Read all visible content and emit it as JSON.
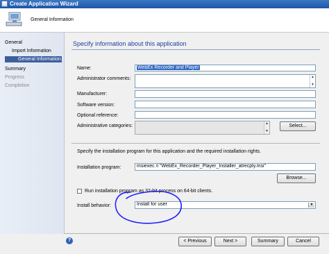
{
  "window": {
    "title": "Create Application Wizard"
  },
  "header": {
    "title": "General Information"
  },
  "nav": {
    "items": [
      {
        "label": "General"
      },
      {
        "label": "Import Information"
      },
      {
        "label": "General Information"
      },
      {
        "label": "Summary"
      },
      {
        "label": "Progress"
      },
      {
        "label": "Completion"
      }
    ]
  },
  "main": {
    "heading": "Specify information about this application",
    "name_label": "Name:",
    "name_value": "WebEx Recorder and Player",
    "admin_comments_label": "Administrator comments:",
    "manufacturer_label": "Manufacturer:",
    "software_version_label": "Software version:",
    "optional_reference_label": "Optional reference:",
    "admin_categories_label": "Administrative categories:",
    "select_button": "Select...",
    "install_instructions": "Specify the installation program for this application and the required installation rights.",
    "install_program_label": "Installation program:",
    "install_program_value": "msiexec /i \"WebEx_Recorder_Player_Installer_atrecply.msi\"",
    "browse_button": "Browse...",
    "run_32bit_label": "Run installation program as 32-bit process on 64-bit clients.",
    "install_behavior_label": "Install behavior:",
    "install_behavior_value": "Install for user"
  },
  "footer": {
    "help_icon": "?",
    "previous": "< Previous",
    "next": "Next >",
    "summary": "Summary",
    "cancel": "Cancel"
  },
  "colors": {
    "annotation_circle": "#1c1cff",
    "heading": "#1c3fa0",
    "nav_selected": "#3d5f9e"
  }
}
